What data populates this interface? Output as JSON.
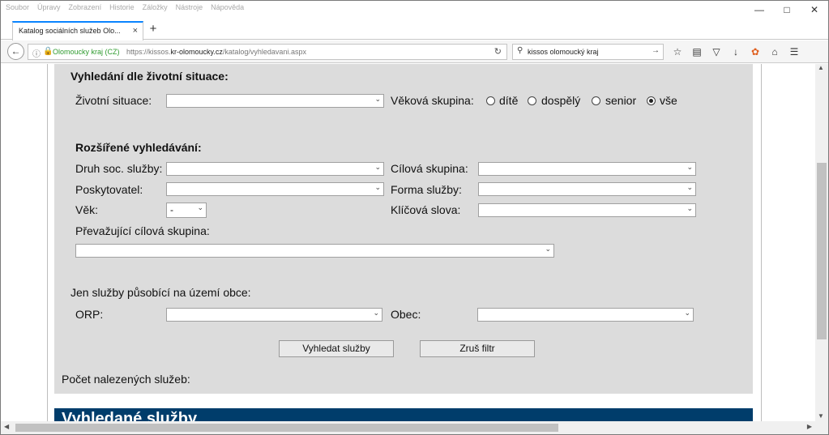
{
  "menu": [
    "Soubor",
    "Úpravy",
    "Zobrazení",
    "Historie",
    "Záložky",
    "Nástroje",
    "Nápověda"
  ],
  "tab": {
    "title": "Katalog sociálních služeb Olo...",
    "close": "×",
    "new": "+"
  },
  "nav": {
    "site_identity": "Olomoucky kraj (CZ)",
    "url_prefix": "https://kissos.",
    "url_domain": "kr-olomoucky.cz",
    "url_path": "/katalog/vyhledavani.aspx",
    "search_value": "kissos olomoucký kraj"
  },
  "form": {
    "life_heading": "Vyhledání dle životní situace:",
    "life_label": "Životní situace:",
    "life_value": "",
    "age_group_label": "Věková skupina:",
    "age_options": [
      {
        "label": "dítě",
        "checked": false
      },
      {
        "label": "dospělý",
        "checked": false
      },
      {
        "label": "senior",
        "checked": false
      },
      {
        "label": "vše",
        "checked": true
      }
    ],
    "ext_heading": "Rozšířené vyhledávání:",
    "service_type_label": "Druh soc. služby:",
    "target_group_label": "Cílová skupina:",
    "provider_label": "Poskytovatel:",
    "service_form_label": "Forma služby:",
    "age_label": "Věk:",
    "age_value": "-",
    "keywords_label": "Klíčová slova:",
    "main_target_label": "Převažující cílová skupina:",
    "municipality_heading": "Jen služby působící na území obce:",
    "orp_label": "ORP:",
    "obec_label": "Obec:",
    "search_button": "Vyhledat služby",
    "reset_button": "Zruš filtr",
    "count_label": "Počet nalezených služeb:"
  },
  "results_heading": "Vyhledané služby",
  "colors": {
    "panel_bg": "#dcdcdc",
    "banner_bg": "#003d6b",
    "tab_accent": "#0a84ff",
    "site_green": "#2f9b2f"
  },
  "icons": [
    "back-icon",
    "info-icon",
    "lock-icon",
    "reload-icon",
    "search-icon",
    "arrow-right-icon",
    "star-icon",
    "reading-list-icon",
    "pocket-icon",
    "download-icon",
    "extension-icon",
    "home-icon",
    "hamburger-menu-icon"
  ]
}
